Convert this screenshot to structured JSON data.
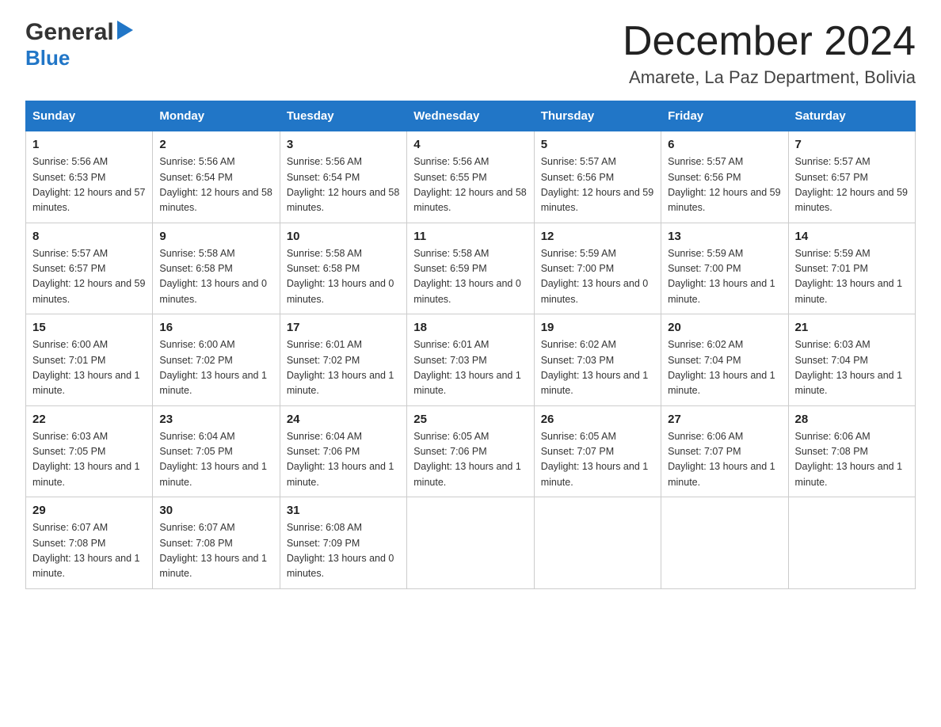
{
  "logo": {
    "general_text": "General",
    "blue_text": "Blue"
  },
  "title": "December 2024",
  "subtitle": "Amarete, La Paz Department, Bolivia",
  "days_of_week": [
    "Sunday",
    "Monday",
    "Tuesday",
    "Wednesday",
    "Thursday",
    "Friday",
    "Saturday"
  ],
  "weeks": [
    [
      {
        "day": "1",
        "sunrise": "5:56 AM",
        "sunset": "6:53 PM",
        "daylight": "12 hours and 57 minutes."
      },
      {
        "day": "2",
        "sunrise": "5:56 AM",
        "sunset": "6:54 PM",
        "daylight": "12 hours and 58 minutes."
      },
      {
        "day": "3",
        "sunrise": "5:56 AM",
        "sunset": "6:54 PM",
        "daylight": "12 hours and 58 minutes."
      },
      {
        "day": "4",
        "sunrise": "5:56 AM",
        "sunset": "6:55 PM",
        "daylight": "12 hours and 58 minutes."
      },
      {
        "day": "5",
        "sunrise": "5:57 AM",
        "sunset": "6:56 PM",
        "daylight": "12 hours and 59 minutes."
      },
      {
        "day": "6",
        "sunrise": "5:57 AM",
        "sunset": "6:56 PM",
        "daylight": "12 hours and 59 minutes."
      },
      {
        "day": "7",
        "sunrise": "5:57 AM",
        "sunset": "6:57 PM",
        "daylight": "12 hours and 59 minutes."
      }
    ],
    [
      {
        "day": "8",
        "sunrise": "5:57 AM",
        "sunset": "6:57 PM",
        "daylight": "12 hours and 59 minutes."
      },
      {
        "day": "9",
        "sunrise": "5:58 AM",
        "sunset": "6:58 PM",
        "daylight": "13 hours and 0 minutes."
      },
      {
        "day": "10",
        "sunrise": "5:58 AM",
        "sunset": "6:58 PM",
        "daylight": "13 hours and 0 minutes."
      },
      {
        "day": "11",
        "sunrise": "5:58 AM",
        "sunset": "6:59 PM",
        "daylight": "13 hours and 0 minutes."
      },
      {
        "day": "12",
        "sunrise": "5:59 AM",
        "sunset": "7:00 PM",
        "daylight": "13 hours and 0 minutes."
      },
      {
        "day": "13",
        "sunrise": "5:59 AM",
        "sunset": "7:00 PM",
        "daylight": "13 hours and 1 minute."
      },
      {
        "day": "14",
        "sunrise": "5:59 AM",
        "sunset": "7:01 PM",
        "daylight": "13 hours and 1 minute."
      }
    ],
    [
      {
        "day": "15",
        "sunrise": "6:00 AM",
        "sunset": "7:01 PM",
        "daylight": "13 hours and 1 minute."
      },
      {
        "day": "16",
        "sunrise": "6:00 AM",
        "sunset": "7:02 PM",
        "daylight": "13 hours and 1 minute."
      },
      {
        "day": "17",
        "sunrise": "6:01 AM",
        "sunset": "7:02 PM",
        "daylight": "13 hours and 1 minute."
      },
      {
        "day": "18",
        "sunrise": "6:01 AM",
        "sunset": "7:03 PM",
        "daylight": "13 hours and 1 minute."
      },
      {
        "day": "19",
        "sunrise": "6:02 AM",
        "sunset": "7:03 PM",
        "daylight": "13 hours and 1 minute."
      },
      {
        "day": "20",
        "sunrise": "6:02 AM",
        "sunset": "7:04 PM",
        "daylight": "13 hours and 1 minute."
      },
      {
        "day": "21",
        "sunrise": "6:03 AM",
        "sunset": "7:04 PM",
        "daylight": "13 hours and 1 minute."
      }
    ],
    [
      {
        "day": "22",
        "sunrise": "6:03 AM",
        "sunset": "7:05 PM",
        "daylight": "13 hours and 1 minute."
      },
      {
        "day": "23",
        "sunrise": "6:04 AM",
        "sunset": "7:05 PM",
        "daylight": "13 hours and 1 minute."
      },
      {
        "day": "24",
        "sunrise": "6:04 AM",
        "sunset": "7:06 PM",
        "daylight": "13 hours and 1 minute."
      },
      {
        "day": "25",
        "sunrise": "6:05 AM",
        "sunset": "7:06 PM",
        "daylight": "13 hours and 1 minute."
      },
      {
        "day": "26",
        "sunrise": "6:05 AM",
        "sunset": "7:07 PM",
        "daylight": "13 hours and 1 minute."
      },
      {
        "day": "27",
        "sunrise": "6:06 AM",
        "sunset": "7:07 PM",
        "daylight": "13 hours and 1 minute."
      },
      {
        "day": "28",
        "sunrise": "6:06 AM",
        "sunset": "7:08 PM",
        "daylight": "13 hours and 1 minute."
      }
    ],
    [
      {
        "day": "29",
        "sunrise": "6:07 AM",
        "sunset": "7:08 PM",
        "daylight": "13 hours and 1 minute."
      },
      {
        "day": "30",
        "sunrise": "6:07 AM",
        "sunset": "7:08 PM",
        "daylight": "13 hours and 1 minute."
      },
      {
        "day": "31",
        "sunrise": "6:08 AM",
        "sunset": "7:09 PM",
        "daylight": "13 hours and 0 minutes."
      },
      null,
      null,
      null,
      null
    ]
  ]
}
